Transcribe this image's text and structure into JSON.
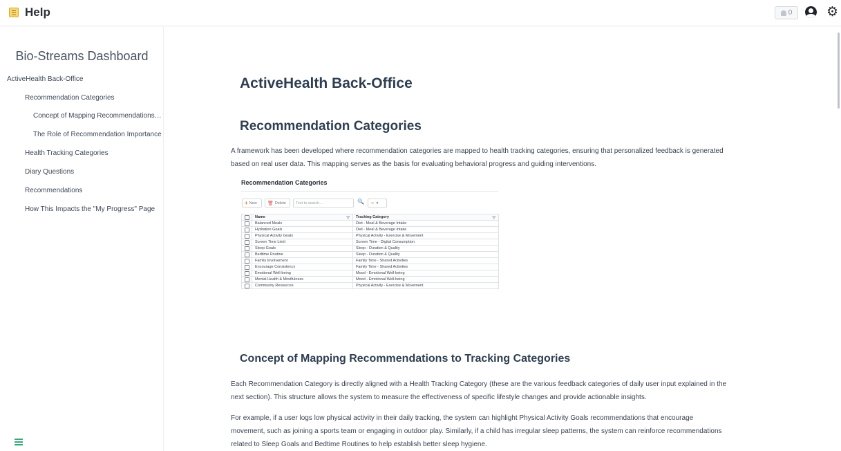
{
  "topbar": {
    "title": "Help",
    "notification_count": "0"
  },
  "sidebar": {
    "title": "Bio-Streams Dashboard",
    "items": [
      {
        "label": "ActiveHealth Back-Office",
        "level": 0
      },
      {
        "label": "Recommendation Categories",
        "level": 1
      },
      {
        "label": "Concept of Mapping Recommendations t...",
        "level": 2
      },
      {
        "label": "The Role of Recommendation Importance",
        "level": 2
      },
      {
        "label": "Health Tracking Categories",
        "level": 1
      },
      {
        "label": "Diary Questions",
        "level": 1
      },
      {
        "label": "Recommendations",
        "level": 1
      },
      {
        "label": "How This Impacts the \"My Progress\" Page",
        "level": 1
      }
    ]
  },
  "main": {
    "h1": "ActiveHealth Back-Office",
    "h2": "Recommendation Categories",
    "intro_line1": "A framework has been developed where recommendation categories are mapped to health tracking categories, ensuring that personalized feedback is generated",
    "intro_line2": "based on real user data. This mapping serves as the basis for evaluating behavioral progress and guiding interventions.",
    "h3": "Concept of Mapping Recommendations to Tracking Categories",
    "p1_line1": "Each Recommendation Category is directly aligned with a Health Tracking Category (these are the various feedback categories of daily user input explained in the",
    "p1_line2": "next section). This structure allows the system to measure the effectiveness of specific lifestyle changes and provide actionable insights.",
    "p2_line1": "For example, if a user logs low physical activity in their daily tracking, the system can highlight Physical Activity Goals recommendations that encourage",
    "p2_line2": "movement, such as joining a sports team or engaging in outdoor play. Similarly, if a child has irregular sleep patterns, the system can reinforce recommendations",
    "p2_line3": "related to Sleep Goals and Bedtime Routines to help establish better sleep hygiene."
  },
  "grid": {
    "title": "Recommendation Categories",
    "toolbar": {
      "new_label": "New",
      "delete_label": "Delete",
      "search_placeholder": "Text to search..."
    },
    "columns": [
      "Name",
      "Tracking Category"
    ],
    "rows": [
      [
        "Balanced Meals",
        "Diet - Meal & Beverage Intake"
      ],
      [
        "Hydration Goals",
        "Diet - Meal & Beverage Intake"
      ],
      [
        "Physical Activity Goals",
        "Physical Activity - Exercise & Movement"
      ],
      [
        "Screen Time Limit",
        "Screen Time - Digital Consumption"
      ],
      [
        "Sleep Goals",
        "Sleep - Duration & Quality"
      ],
      [
        "Bedtime Routine",
        "Sleep - Duration & Quality"
      ],
      [
        "Family Involvement",
        "Family Time - Shared Activities"
      ],
      [
        "Encourage Consistency",
        "Family Time - Shared Activities"
      ],
      [
        "Emotional Well-being",
        "Mood - Emotional Well-being"
      ],
      [
        "Mental Health & Mindfulness",
        "Mood - Emotional Well-being"
      ],
      [
        "Community Resources",
        "Physical Activity - Exercise & Movement"
      ]
    ]
  }
}
